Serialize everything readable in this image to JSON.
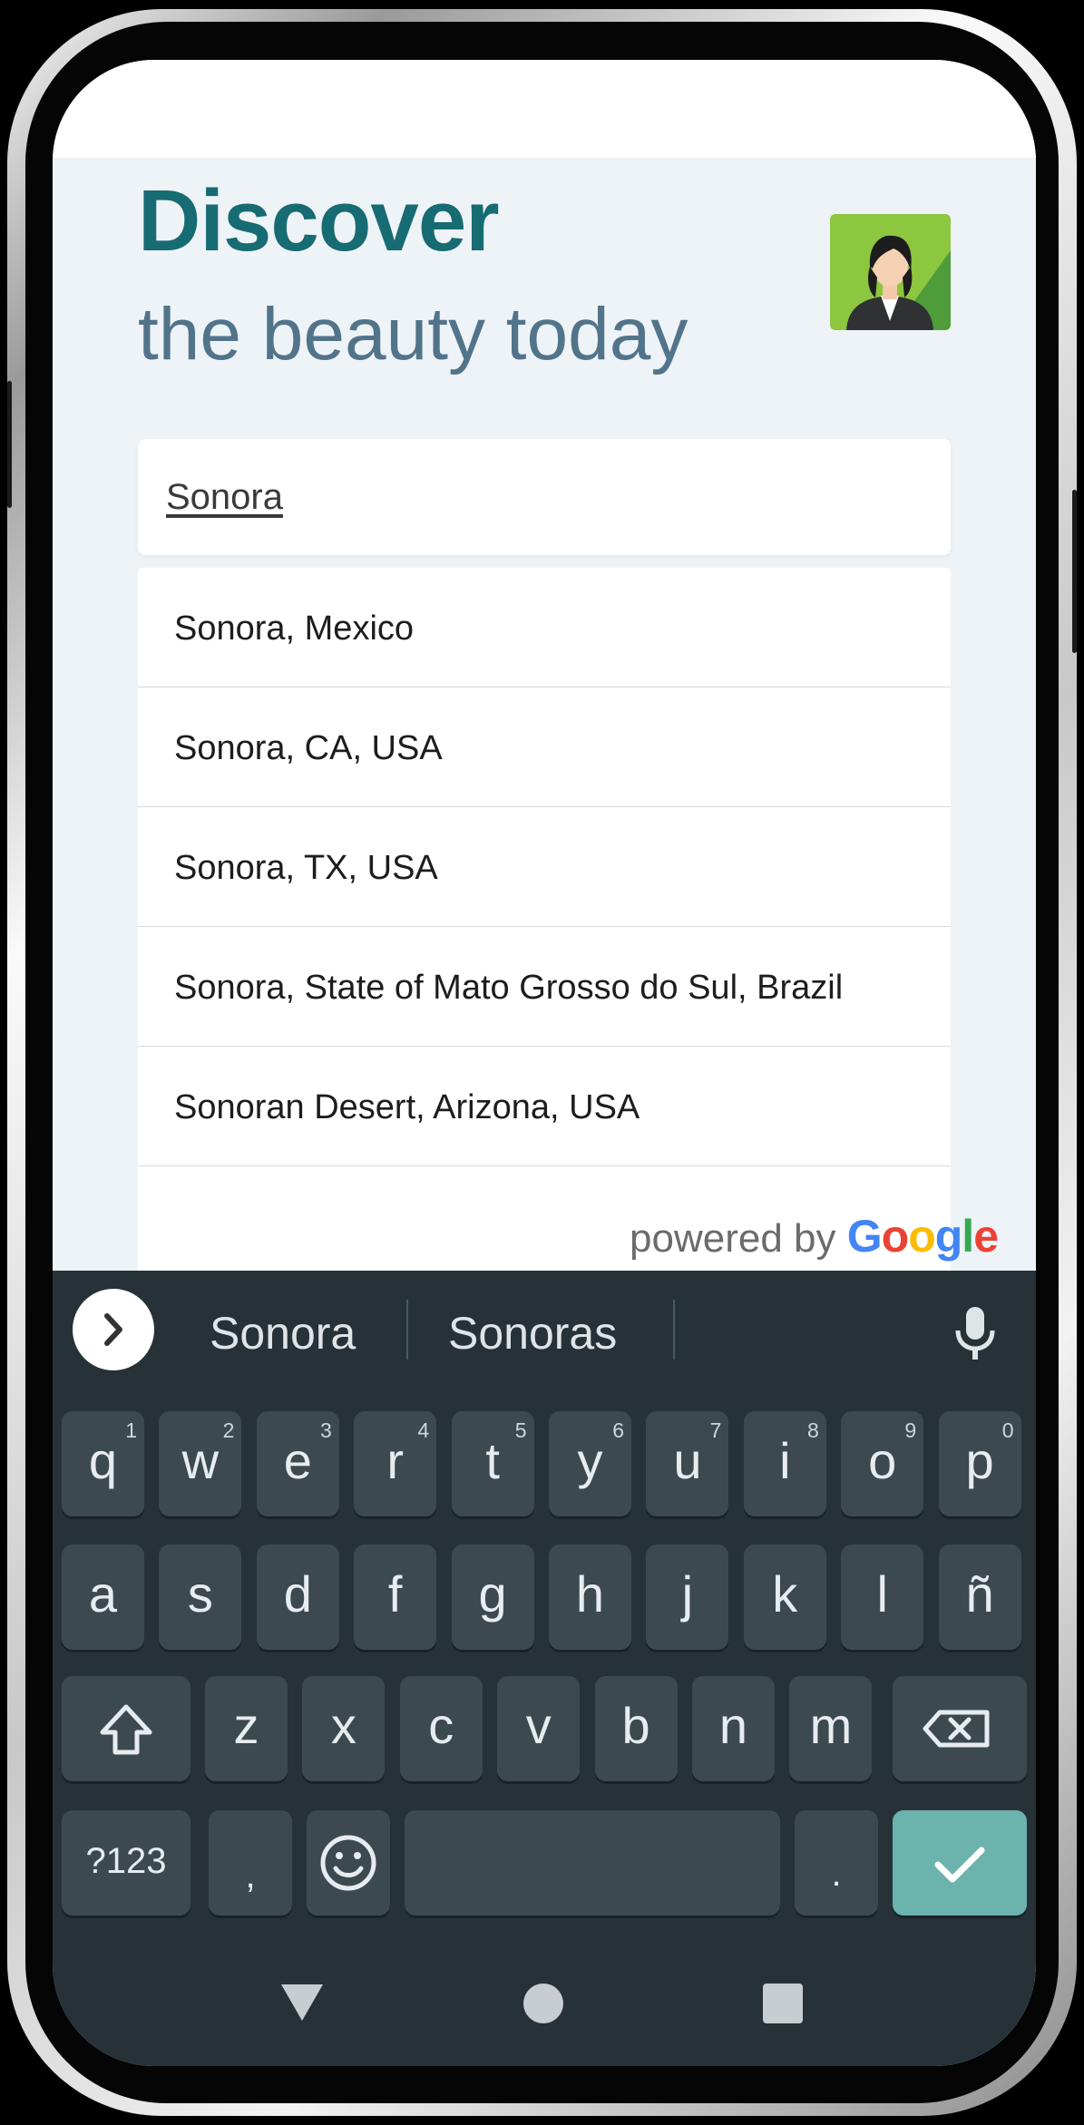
{
  "header": {
    "title": "Discover",
    "subtitle": "the beauty today",
    "avatar_icon": "profile-woman-avatar"
  },
  "search": {
    "value": "Sonora"
  },
  "suggestions": [
    "Sonora, Mexico",
    "Sonora, CA, USA",
    "Sonora, TX, USA",
    "Sonora, State of Mato Grosso do Sul, Brazil",
    "Sonoran Desert, Arizona, USA"
  ],
  "attribution": {
    "prefix": "powered by",
    "brand_letters": [
      "G",
      "o",
      "o",
      "g",
      "l",
      "e"
    ],
    "brand_colors": [
      "#4285F4",
      "#EA4335",
      "#FBBC05",
      "#4285F4",
      "#34A853",
      "#EA4335"
    ]
  },
  "keyboard": {
    "suggestions": [
      "Sonora",
      "Sonoras"
    ],
    "row1": [
      {
        "key": "q",
        "sup": "1"
      },
      {
        "key": "w",
        "sup": "2"
      },
      {
        "key": "e",
        "sup": "3"
      },
      {
        "key": "r",
        "sup": "4"
      },
      {
        "key": "t",
        "sup": "5"
      },
      {
        "key": "y",
        "sup": "6"
      },
      {
        "key": "u",
        "sup": "7"
      },
      {
        "key": "i",
        "sup": "8"
      },
      {
        "key": "o",
        "sup": "9"
      },
      {
        "key": "p",
        "sup": "0"
      }
    ],
    "row2": [
      "a",
      "s",
      "d",
      "f",
      "g",
      "h",
      "j",
      "k",
      "l",
      "ñ"
    ],
    "row3": [
      "z",
      "x",
      "c",
      "v",
      "b",
      "n",
      "m"
    ],
    "bottom": {
      "symbols": "?123",
      "comma": ",",
      "period": "."
    },
    "icons": {
      "expand": "chevron-right-icon",
      "mic": "microphone-icon",
      "shift": "shift-icon",
      "backspace": "backspace-icon",
      "emoji": "emoji-icon",
      "enter": "checkmark-icon"
    },
    "accent_color": "#6db3ad"
  },
  "navbar": {
    "icons": [
      "back-triangle-icon",
      "home-circle-icon",
      "recents-square-icon"
    ]
  }
}
